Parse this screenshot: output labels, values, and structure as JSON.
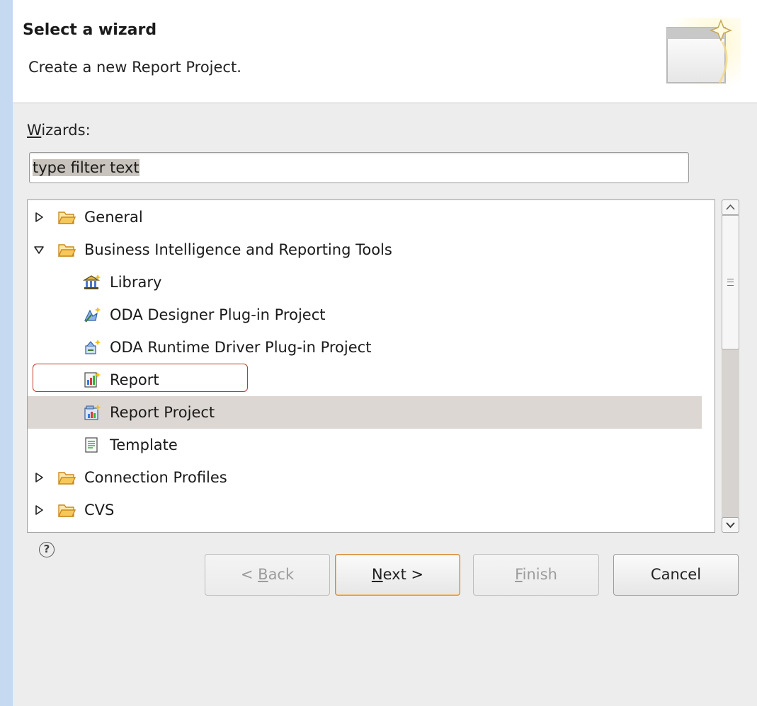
{
  "header": {
    "title": "Select a wizard",
    "description": "Create a new Report Project."
  },
  "wizards": {
    "label_mnemonic": "W",
    "label_rest": "izards:",
    "filter_value": "type filter text"
  },
  "tree": {
    "items": [
      {
        "label": "General",
        "level": 0,
        "expanded": false,
        "icon": "folder-icon"
      },
      {
        "label": "Business Intelligence and Reporting Tools",
        "level": 0,
        "expanded": true,
        "icon": "folder-icon"
      },
      {
        "label": "Library",
        "level": 1,
        "icon": "library-icon"
      },
      {
        "label": "ODA Designer Plug-in Project",
        "level": 1,
        "icon": "oda-designer-icon"
      },
      {
        "label": "ODA Runtime Driver Plug-in Project",
        "level": 1,
        "icon": "oda-runtime-icon"
      },
      {
        "label": "Report",
        "level": 1,
        "icon": "report-icon"
      },
      {
        "label": "Report Project",
        "level": 1,
        "icon": "report-project-icon",
        "selected": true
      },
      {
        "label": "Template",
        "level": 1,
        "icon": "template-icon"
      },
      {
        "label": "Connection Profiles",
        "level": 0,
        "expanded": false,
        "icon": "folder-icon"
      },
      {
        "label": "CVS",
        "level": 0,
        "expanded": false,
        "icon": "folder-icon"
      }
    ]
  },
  "buttons": {
    "help": "?",
    "back_prefix": "< ",
    "back_mnemonic": "B",
    "back_rest": "ack",
    "next_mnemonic": "N",
    "next_rest": "ext >",
    "finish_mnemonic": "F",
    "finish_rest": "inish",
    "cancel": "Cancel"
  },
  "colors": {
    "selection": "#dcd7d2",
    "highlight_box": "#c0392b",
    "folder": "#e7a83a",
    "default_button_border": "#d18a3a"
  }
}
